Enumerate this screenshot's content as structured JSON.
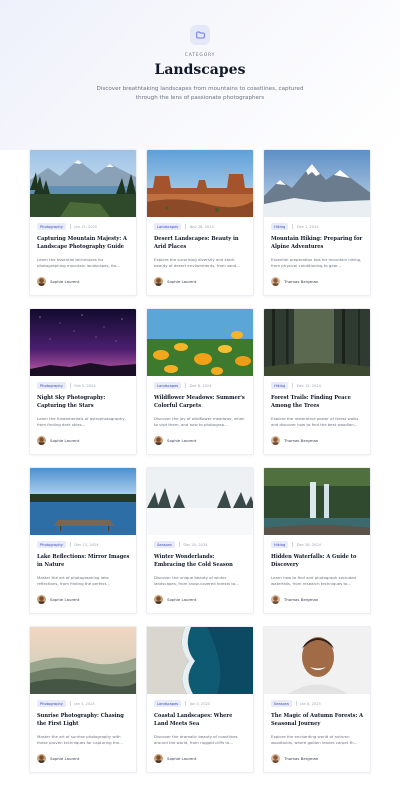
{
  "header": {
    "category_label": "CATEGORY",
    "title": "Landscapes",
    "description": "Discover breathtaking landscapes from mountains to coastlines, captured through the lens of passionate photographers"
  },
  "colors": {
    "accent": "#3b4ab8",
    "tag_bg": "#e8ebfb",
    "icon_bg": "#e4e8f8"
  },
  "posts": [
    {
      "tag": "Photography",
      "date": "Jan 15, 2025",
      "title": "Capturing Mountain Majesty: A Landscape Photography Guide",
      "excerpt": "Learn the essential techniques for photographing mountain landscapes, fro...",
      "author": "Sophie Laurent",
      "image": "mountain-lake"
    },
    {
      "tag": "Landscapes",
      "date": "Nov 28, 2024",
      "title": "Desert Landscapes: Beauty in Arid Places",
      "excerpt": "Explore the surprising diversity and stark beauty of desert environments, from sand...",
      "author": "Sophie Laurent",
      "image": "desert-mesas"
    },
    {
      "tag": "Hiking",
      "date": "Dec 1, 2024",
      "title": "Mountain Hiking: Preparing for Alpine Adventures",
      "excerpt": "Essential preparation tips for mountain hiking, from physical conditioning to gear...",
      "author": "Thomas Bergman",
      "image": "snowy-peaks"
    },
    {
      "tag": "Photography",
      "date": "Feb 5, 2024",
      "title": "Night Sky Photography: Capturing the Stars",
      "excerpt": "Learn the fundamentals of astrophotography, from finding dark skies...",
      "author": "Sophie Laurent",
      "image": "night-sky"
    },
    {
      "tag": "Landscapes",
      "date": "Dec 8, 2024",
      "title": "Wildflower Meadows: Summer's Colorful Carpets",
      "excerpt": "Discover the joy of wildflower meadows, when to visit them, and how to photograp...",
      "author": "Sophie Laurent",
      "image": "wildflowers"
    },
    {
      "tag": "Hiking",
      "date": "Dec 15, 2024",
      "title": "Forest Trails: Finding Peace Among the Trees",
      "excerpt": "Explore the restorative power of forest walks and discover how to find the best woodlan...",
      "author": "Thomas Bergman",
      "image": "forest"
    },
    {
      "tag": "Photography",
      "date": "Dec 13, 2024",
      "title": "Lake Reflections: Mirror Images in Nature",
      "excerpt": "Master the art of photographing lake reflections, from finding the perfect...",
      "author": "Sophie Laurent",
      "image": "lake-pier"
    },
    {
      "tag": "Seasons",
      "date": "Dec 20, 2024",
      "title": "Winter Wonderlands: Embracing the Cold Season",
      "excerpt": "Discover the unique beauty of winter landscapes, from snow-covered forests to...",
      "author": "Sophie Laurent",
      "image": "winter-forest"
    },
    {
      "tag": "Hiking",
      "date": "Dec 28, 2024",
      "title": "Hidden Waterfalls: A Guide to Discovery",
      "excerpt": "Learn how to find and photograph secluded waterfalls, from research techniques to...",
      "author": "Thomas Bergman",
      "image": "waterfall"
    },
    {
      "tag": "Photography",
      "date": "Jan 3, 2025",
      "title": "Sunrise Photography: Chasing the First Light",
      "excerpt": "Master the art of sunrise photography with these proven techniques for capturing the...",
      "author": "Sophie Laurent",
      "image": "misty-hills"
    },
    {
      "tag": "Landscapes",
      "date": "Jan 5, 2025",
      "title": "Coastal Landscapes: Where Land Meets Sea",
      "excerpt": "Discover the dramatic beauty of coastlines around the world, from rugged cliffs to...",
      "author": "Sophie Laurent",
      "image": "coast-aerial"
    },
    {
      "tag": "Seasons",
      "date": "Jan 8, 2025",
      "title": "The Magic of Autumn Forests: A Seasonal Journey",
      "excerpt": "Explore the enchanting world of autumn woodlands, where golden leaves carpet th...",
      "author": "Thomas Bergman",
      "image": "portrait"
    }
  ]
}
